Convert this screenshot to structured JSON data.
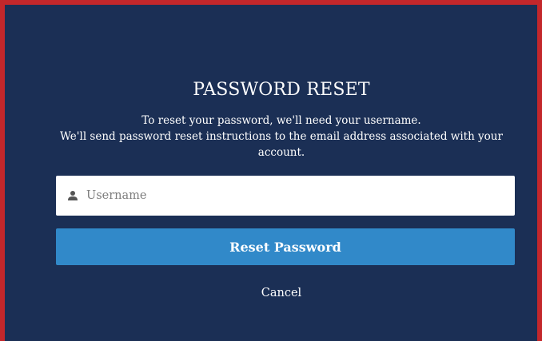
{
  "dialog": {
    "title": "PASSWORD RESET",
    "instructions_line1": "To reset your password, we'll need your username.",
    "instructions_line2": "We'll send password reset instructions to the email address associated with your account.",
    "username": {
      "icon": "user-icon",
      "placeholder": "Username",
      "value": ""
    },
    "reset_button_label": "Reset Password",
    "cancel_label": "Cancel"
  },
  "colors": {
    "background": "#1b2f55",
    "border": "#c3272b",
    "button": "#3189c9",
    "text": "#ffffff"
  }
}
